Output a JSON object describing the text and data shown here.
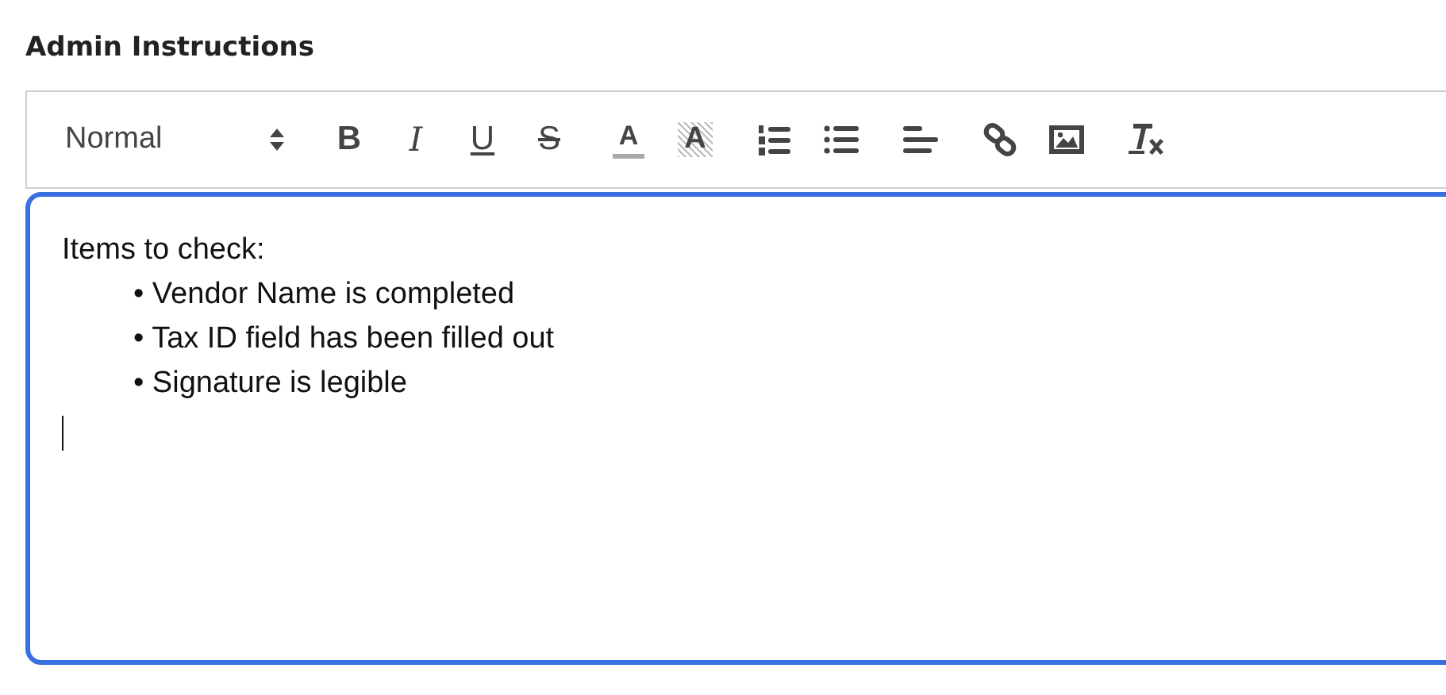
{
  "heading": "Admin Instructions",
  "toolbar": {
    "format_select": "Normal",
    "groups": [
      [
        {
          "kind": "bold",
          "label": "B"
        },
        {
          "kind": "italic",
          "label": "I"
        },
        {
          "kind": "underline",
          "label": "U"
        },
        {
          "kind": "strike",
          "label": "S"
        }
      ],
      [
        {
          "kind": "color",
          "label": "A"
        },
        {
          "kind": "background",
          "label": "A"
        }
      ],
      [
        {
          "kind": "ordered-list"
        },
        {
          "kind": "bullet-list"
        }
      ],
      [
        {
          "kind": "align"
        }
      ],
      [
        {
          "kind": "link"
        },
        {
          "kind": "image"
        }
      ],
      [
        {
          "kind": "clean"
        }
      ]
    ]
  },
  "editor": {
    "focused": true,
    "lines": [
      {
        "text": "Items to check:",
        "indent": false
      },
      {
        "text": "• Vendor Name is completed",
        "indent": true
      },
      {
        "text": "• Tax ID field has been filled out",
        "indent": true
      },
      {
        "text": "• Signature is legible",
        "indent": true
      }
    ]
  }
}
